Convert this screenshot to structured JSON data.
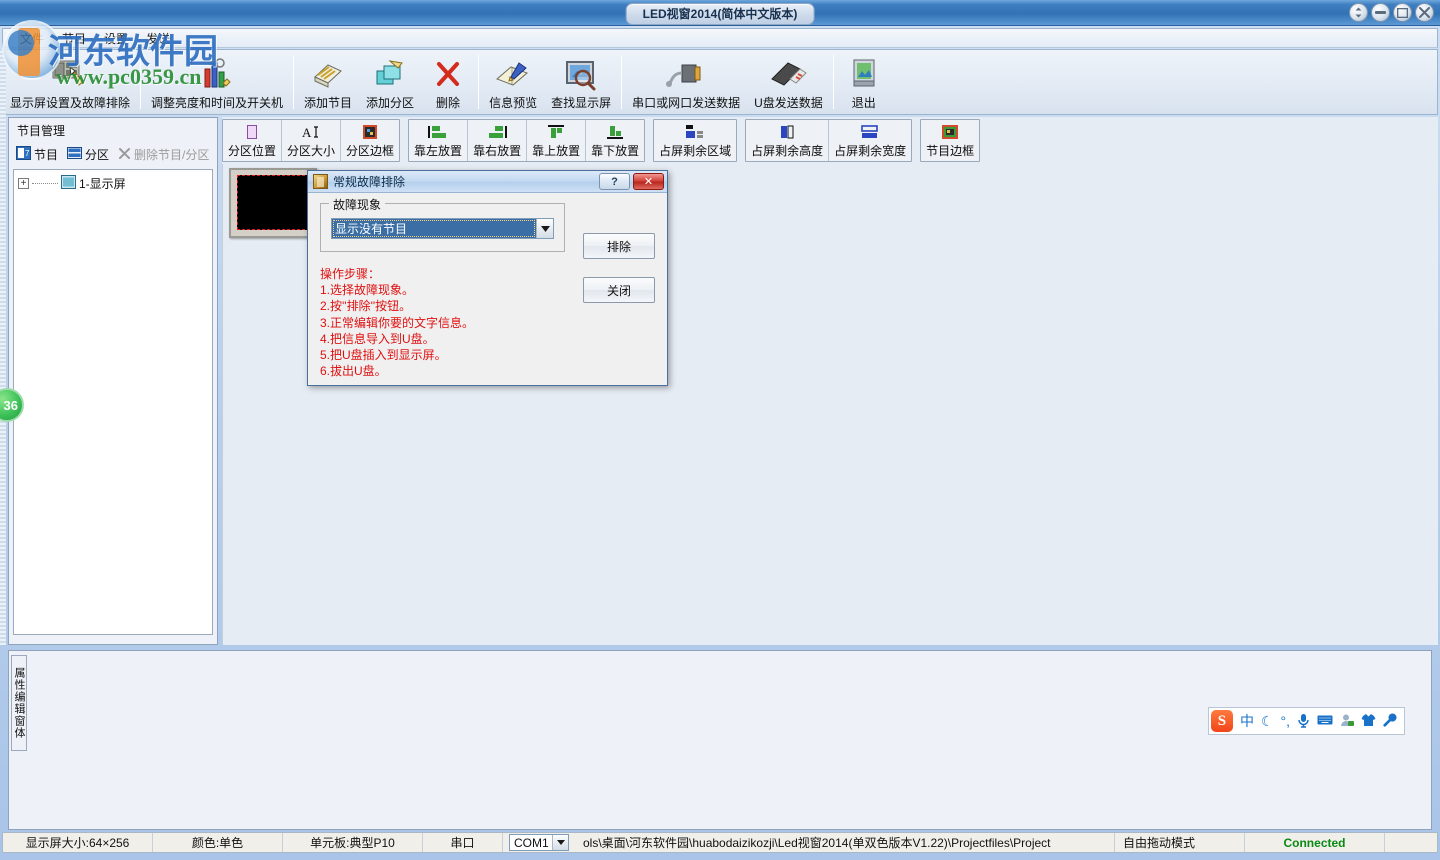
{
  "window": {
    "title": "LED视窗2014(简体中文版本)",
    "controls": [
      {
        "name": "shade-button",
        "glyph": "⇅"
      },
      {
        "name": "minimize-button",
        "glyph": "–"
      },
      {
        "name": "maximize-button",
        "glyph": "□"
      },
      {
        "name": "close-button",
        "glyph": "×"
      }
    ]
  },
  "menubar": {
    "items": [
      {
        "label": "文件",
        "name": "menu-file"
      },
      {
        "label": "节目",
        "name": "menu-program"
      },
      {
        "label": "设置",
        "name": "menu-settings"
      },
      {
        "label": "发送",
        "name": "menu-send"
      }
    ]
  },
  "toolbar_main": {
    "groups": [
      {
        "buttons": [
          {
            "label": "显示屏设置及故障排除",
            "icon": "screen-settings-icon",
            "name": "toolbar-screen-settings"
          }
        ]
      },
      {
        "buttons": [
          {
            "label": "调整亮度和时间及开关机",
            "icon": "brightness-time-icon",
            "name": "toolbar-brightness-time"
          }
        ]
      },
      {
        "buttons": [
          {
            "label": "添加节目",
            "icon": "add-program-icon",
            "name": "toolbar-add-program"
          },
          {
            "label": "添加分区",
            "icon": "add-partition-icon",
            "name": "toolbar-add-partition"
          },
          {
            "label": "删除",
            "icon": "delete-icon",
            "name": "toolbar-delete"
          }
        ]
      },
      {
        "buttons": [
          {
            "label": "信息预览",
            "icon": "preview-icon",
            "name": "toolbar-preview"
          },
          {
            "label": "查找显示屏",
            "icon": "find-screen-icon",
            "name": "toolbar-find-screen"
          }
        ]
      },
      {
        "buttons": [
          {
            "label": "串口或网口发送数据",
            "icon": "serial-network-send-icon",
            "name": "toolbar-serial-send"
          },
          {
            "label": "U盘发送数据",
            "icon": "usb-send-icon",
            "name": "toolbar-usb-send"
          }
        ]
      },
      {
        "buttons": [
          {
            "label": "退出",
            "icon": "exit-icon",
            "name": "toolbar-exit"
          }
        ]
      }
    ]
  },
  "toolbar_layout": {
    "groups": [
      {
        "buttons": [
          {
            "label": "分区位置",
            "icon": "partition-position-icon",
            "name": "tool-partition-position"
          },
          {
            "label": "分区大小",
            "icon": "partition-size-icon",
            "name": "tool-partition-size"
          },
          {
            "label": "分区边框",
            "icon": "partition-border-icon",
            "name": "tool-partition-border"
          }
        ]
      },
      {
        "buttons": [
          {
            "label": "靠左放置",
            "icon": "align-left-icon",
            "name": "tool-align-left"
          },
          {
            "label": "靠右放置",
            "icon": "align-right-icon",
            "name": "tool-align-right"
          },
          {
            "label": "靠上放置",
            "icon": "align-top-icon",
            "name": "tool-align-top"
          },
          {
            "label": "靠下放置",
            "icon": "align-bottom-icon",
            "name": "tool-align-bottom"
          }
        ]
      },
      {
        "buttons": [
          {
            "label": "占屏剩余区域",
            "icon": "fill-remaining-area-icon",
            "name": "tool-fill-area"
          }
        ]
      },
      {
        "buttons": [
          {
            "label": "占屏剩余高度",
            "icon": "fill-remaining-height-icon",
            "name": "tool-fill-height"
          },
          {
            "label": "占屏剩余宽度",
            "icon": "fill-remaining-width-icon",
            "name": "tool-fill-width"
          }
        ]
      },
      {
        "buttons": [
          {
            "label": "节目边框",
            "icon": "program-border-icon",
            "name": "tool-program-border"
          }
        ]
      }
    ]
  },
  "left_panel": {
    "title": "节目管理",
    "actions": [
      {
        "label": "节目",
        "icon": "program-icon",
        "name": "panel-add-program",
        "enabled": true
      },
      {
        "label": "分区",
        "icon": "partition-icon",
        "name": "panel-add-partition",
        "enabled": true
      },
      {
        "label": "删除节目/分区",
        "icon": "delete-x-icon",
        "name": "panel-delete",
        "enabled": false
      }
    ],
    "tree": [
      {
        "label": "1-显示屏",
        "name": "tree-node-screen1",
        "expander": "+"
      }
    ]
  },
  "dialog": {
    "title": "常规故障排除",
    "icon": "troubleshoot-icon",
    "help_label": "?",
    "close_label": "✕",
    "fieldset_legend": "故障现象",
    "combo": {
      "value": "显示没有节目",
      "name": "fault-phenomenon-combo"
    },
    "buttons": [
      {
        "label": "排除",
        "name": "eliminate-button"
      },
      {
        "label": "关闭",
        "name": "close-button"
      }
    ],
    "steps_title": "操作步骤：",
    "steps": [
      "1.选择故障现象。",
      "2.按''排除''按钮。",
      "3.正常编辑你要的文字信息。",
      "4.把信息导入到U盘。",
      "5.把U盘插入到显示屏。",
      "6.拔出U盘。"
    ]
  },
  "property_panel": {
    "vertical_label": "属性编辑窗体"
  },
  "ime": {
    "logo": "S",
    "items": [
      {
        "glyph": "中",
        "name": "ime-chinese-mode-icon"
      },
      {
        "glyph": "☾",
        "name": "ime-moon-icon"
      },
      {
        "glyph": "°,",
        "name": "ime-punctuation-icon"
      },
      {
        "glyph": "🎤",
        "name": "ime-voice-icon"
      },
      {
        "glyph": "⌨",
        "name": "ime-keyboard-icon"
      },
      {
        "glyph": "👤",
        "name": "ime-account-icon"
      },
      {
        "glyph": "👕",
        "name": "ime-skin-icon"
      },
      {
        "glyph": "🔧",
        "name": "ime-tools-icon"
      }
    ]
  },
  "statusbar": {
    "screen_size": "显示屏大小:64×256",
    "color": "颜色:单色",
    "unit_board": "单元板:典型P10",
    "port_label": "串口",
    "port_value": "COM1",
    "file_path": "ols\\桌面\\河东软件园\\huabodaizikozji\\Led视窗2014(单双色版本V1.22)\\Projectfiles\\Project",
    "mode": "自由拖动模式",
    "connection": "Connected"
  },
  "badge": {
    "value": "36"
  },
  "watermark": {
    "text_cn": "河东软件园",
    "text_url": "www.pc0359.cn"
  }
}
